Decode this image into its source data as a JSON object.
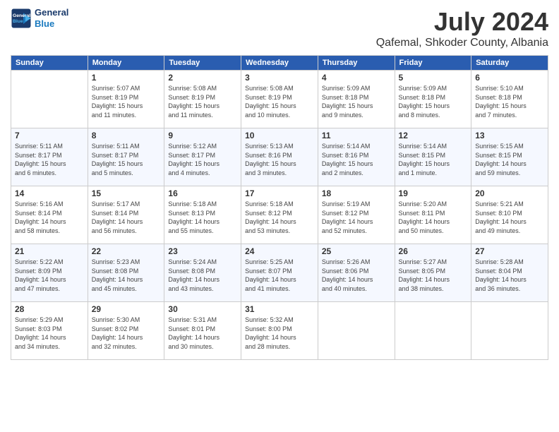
{
  "header": {
    "logo_line1": "General",
    "logo_line2": "Blue",
    "month": "July 2024",
    "location": "Qafemal, Shkoder County, Albania"
  },
  "weekdays": [
    "Sunday",
    "Monday",
    "Tuesday",
    "Wednesday",
    "Thursday",
    "Friday",
    "Saturday"
  ],
  "weeks": [
    [
      {
        "day": "",
        "info": ""
      },
      {
        "day": "1",
        "info": "Sunrise: 5:07 AM\nSunset: 8:19 PM\nDaylight: 15 hours\nand 11 minutes."
      },
      {
        "day": "2",
        "info": "Sunrise: 5:08 AM\nSunset: 8:19 PM\nDaylight: 15 hours\nand 11 minutes."
      },
      {
        "day": "3",
        "info": "Sunrise: 5:08 AM\nSunset: 8:19 PM\nDaylight: 15 hours\nand 10 minutes."
      },
      {
        "day": "4",
        "info": "Sunrise: 5:09 AM\nSunset: 8:18 PM\nDaylight: 15 hours\nand 9 minutes."
      },
      {
        "day": "5",
        "info": "Sunrise: 5:09 AM\nSunset: 8:18 PM\nDaylight: 15 hours\nand 8 minutes."
      },
      {
        "day": "6",
        "info": "Sunrise: 5:10 AM\nSunset: 8:18 PM\nDaylight: 15 hours\nand 7 minutes."
      }
    ],
    [
      {
        "day": "7",
        "info": "Sunrise: 5:11 AM\nSunset: 8:17 PM\nDaylight: 15 hours\nand 6 minutes."
      },
      {
        "day": "8",
        "info": "Sunrise: 5:11 AM\nSunset: 8:17 PM\nDaylight: 15 hours\nand 5 minutes."
      },
      {
        "day": "9",
        "info": "Sunrise: 5:12 AM\nSunset: 8:17 PM\nDaylight: 15 hours\nand 4 minutes."
      },
      {
        "day": "10",
        "info": "Sunrise: 5:13 AM\nSunset: 8:16 PM\nDaylight: 15 hours\nand 3 minutes."
      },
      {
        "day": "11",
        "info": "Sunrise: 5:14 AM\nSunset: 8:16 PM\nDaylight: 15 hours\nand 2 minutes."
      },
      {
        "day": "12",
        "info": "Sunrise: 5:14 AM\nSunset: 8:15 PM\nDaylight: 15 hours\nand 1 minute."
      },
      {
        "day": "13",
        "info": "Sunrise: 5:15 AM\nSunset: 8:15 PM\nDaylight: 14 hours\nand 59 minutes."
      }
    ],
    [
      {
        "day": "14",
        "info": "Sunrise: 5:16 AM\nSunset: 8:14 PM\nDaylight: 14 hours\nand 58 minutes."
      },
      {
        "day": "15",
        "info": "Sunrise: 5:17 AM\nSunset: 8:14 PM\nDaylight: 14 hours\nand 56 minutes."
      },
      {
        "day": "16",
        "info": "Sunrise: 5:18 AM\nSunset: 8:13 PM\nDaylight: 14 hours\nand 55 minutes."
      },
      {
        "day": "17",
        "info": "Sunrise: 5:18 AM\nSunset: 8:12 PM\nDaylight: 14 hours\nand 53 minutes."
      },
      {
        "day": "18",
        "info": "Sunrise: 5:19 AM\nSunset: 8:12 PM\nDaylight: 14 hours\nand 52 minutes."
      },
      {
        "day": "19",
        "info": "Sunrise: 5:20 AM\nSunset: 8:11 PM\nDaylight: 14 hours\nand 50 minutes."
      },
      {
        "day": "20",
        "info": "Sunrise: 5:21 AM\nSunset: 8:10 PM\nDaylight: 14 hours\nand 49 minutes."
      }
    ],
    [
      {
        "day": "21",
        "info": "Sunrise: 5:22 AM\nSunset: 8:09 PM\nDaylight: 14 hours\nand 47 minutes."
      },
      {
        "day": "22",
        "info": "Sunrise: 5:23 AM\nSunset: 8:08 PM\nDaylight: 14 hours\nand 45 minutes."
      },
      {
        "day": "23",
        "info": "Sunrise: 5:24 AM\nSunset: 8:08 PM\nDaylight: 14 hours\nand 43 minutes."
      },
      {
        "day": "24",
        "info": "Sunrise: 5:25 AM\nSunset: 8:07 PM\nDaylight: 14 hours\nand 41 minutes."
      },
      {
        "day": "25",
        "info": "Sunrise: 5:26 AM\nSunset: 8:06 PM\nDaylight: 14 hours\nand 40 minutes."
      },
      {
        "day": "26",
        "info": "Sunrise: 5:27 AM\nSunset: 8:05 PM\nDaylight: 14 hours\nand 38 minutes."
      },
      {
        "day": "27",
        "info": "Sunrise: 5:28 AM\nSunset: 8:04 PM\nDaylight: 14 hours\nand 36 minutes."
      }
    ],
    [
      {
        "day": "28",
        "info": "Sunrise: 5:29 AM\nSunset: 8:03 PM\nDaylight: 14 hours\nand 34 minutes."
      },
      {
        "day": "29",
        "info": "Sunrise: 5:30 AM\nSunset: 8:02 PM\nDaylight: 14 hours\nand 32 minutes."
      },
      {
        "day": "30",
        "info": "Sunrise: 5:31 AM\nSunset: 8:01 PM\nDaylight: 14 hours\nand 30 minutes."
      },
      {
        "day": "31",
        "info": "Sunrise: 5:32 AM\nSunset: 8:00 PM\nDaylight: 14 hours\nand 28 minutes."
      },
      {
        "day": "",
        "info": ""
      },
      {
        "day": "",
        "info": ""
      },
      {
        "day": "",
        "info": ""
      }
    ]
  ]
}
